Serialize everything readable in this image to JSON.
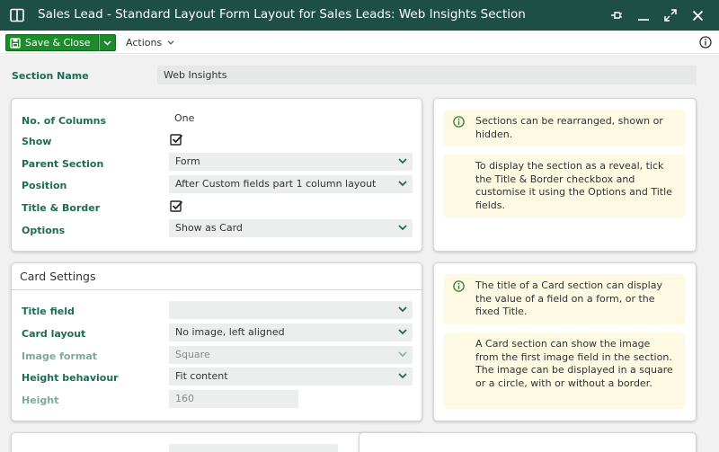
{
  "window": {
    "title": "Sales Lead - Standard Layout Form Layout for Sales Leads: Web Insights Section"
  },
  "toolbar": {
    "save_label": "Save & Close",
    "actions_label": "Actions"
  },
  "section_name": {
    "label": "Section Name",
    "value": "Web Insights"
  },
  "general": {
    "columns_label": "No. of Columns",
    "columns_value": "One",
    "show_label": "Show",
    "show_checked": true,
    "parent_label": "Parent Section",
    "parent_value": "Form",
    "position_label": "Position",
    "position_value": "After Custom fields part 1 column layout",
    "title_border_label": "Title & Border",
    "title_border_checked": true,
    "options_label": "Options",
    "options_value": "Show as Card"
  },
  "notes_general": [
    "Sections can be rearranged, shown or hidden.",
    "To display the section as a reveal, tick the Title & Border checkbox and customise it using the Options and Title fields."
  ],
  "card_settings": {
    "header": "Card Settings",
    "title_field_label": "Title field",
    "title_field_value": "",
    "card_layout_label": "Card layout",
    "card_layout_value": "No image, left aligned",
    "image_format_label": "Image format",
    "image_format_value": "Square",
    "height_behaviour_label": "Height behaviour",
    "height_behaviour_value": "Fit content",
    "height_label": "Height",
    "height_value": "160"
  },
  "notes_card": [
    "The title of a Card section can display the value of a field on a form, or the fixed Title.",
    "A Card section can show the image from the first image field in the section. The image can be displayed in a square or a circle, with or without a border."
  ],
  "colors": {
    "titlebar": "#1e4f45",
    "save_button": "#1d8a2c",
    "label_green": "#1e6b56",
    "note_background": "#fdf9e2"
  }
}
